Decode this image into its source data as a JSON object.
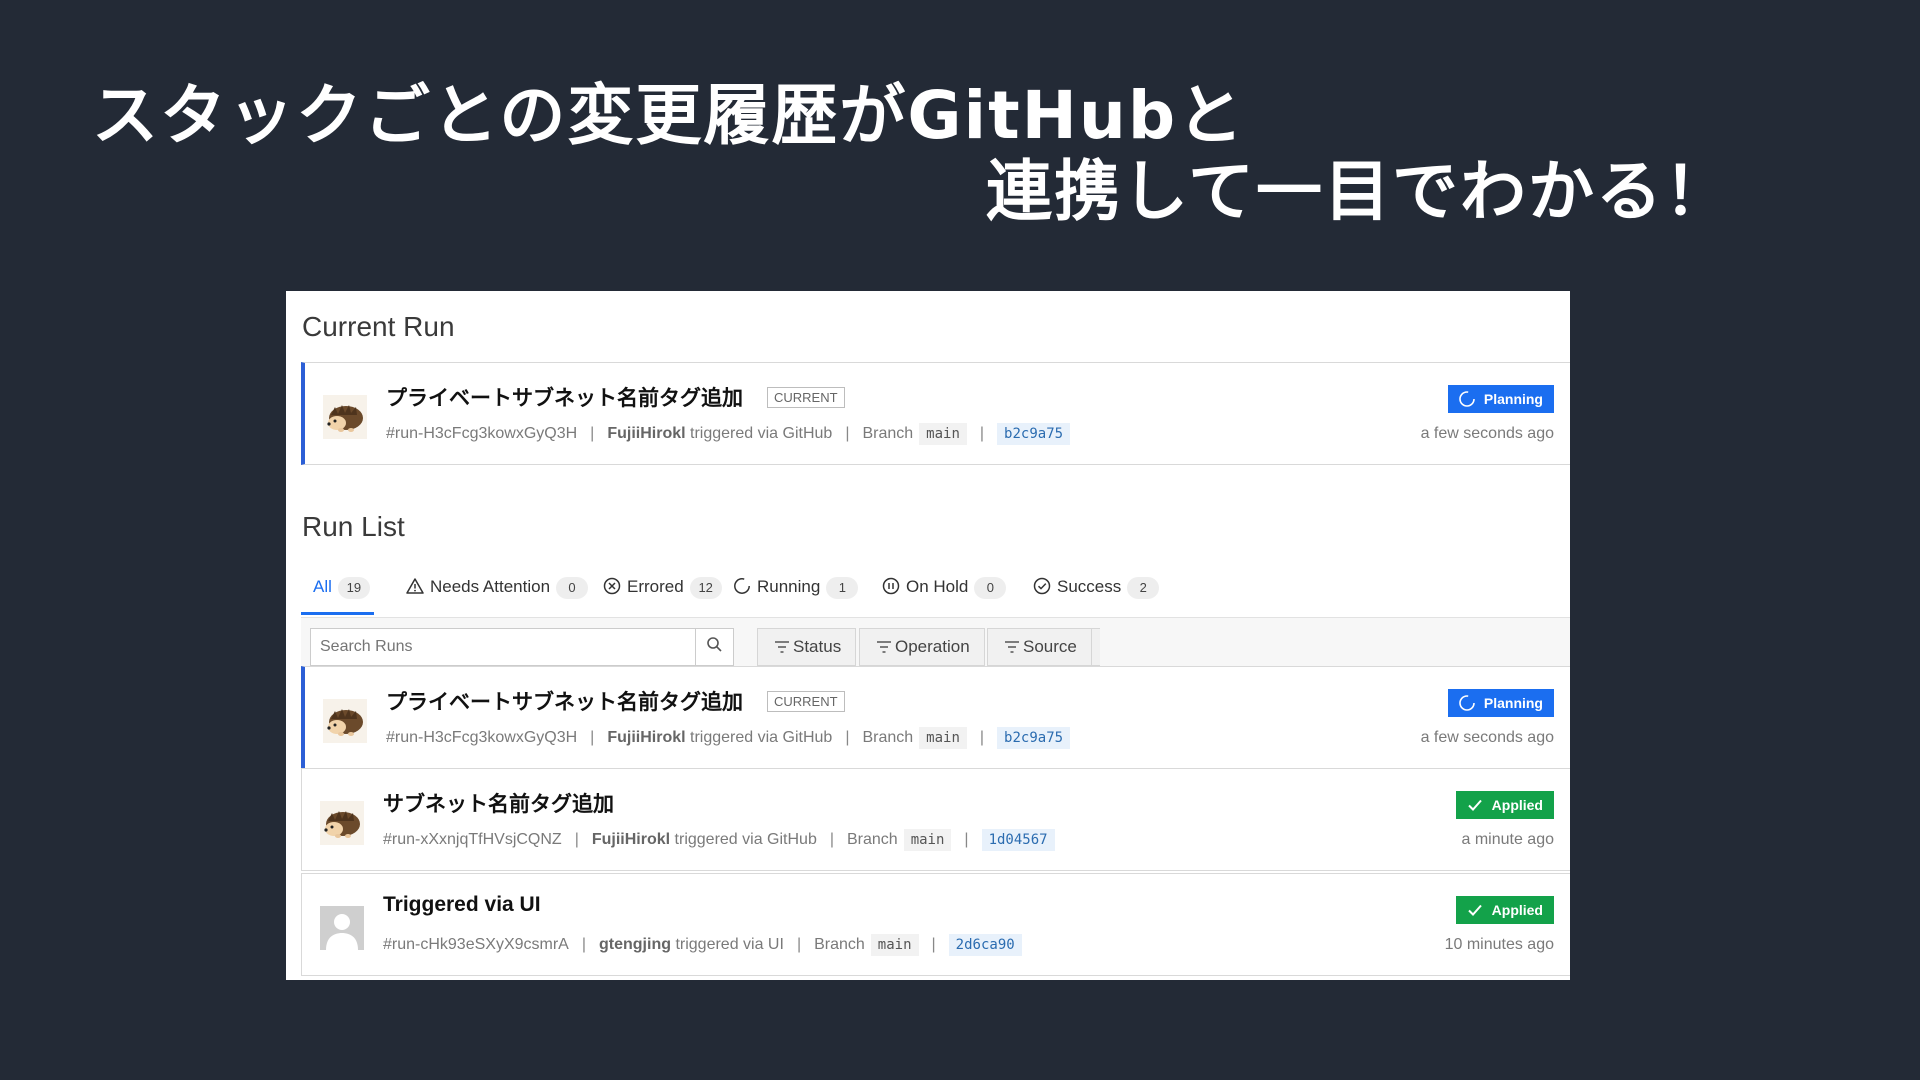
{
  "slide": {
    "title_line1": "スタックごとの変更履歴がGitHubと",
    "title_line2": "連携して一目でわかる！"
  },
  "current_run": {
    "heading": "Current Run",
    "run": {
      "title": "プライベートサブネット名前タグ追加",
      "tag": "CURRENT",
      "id": "#run-H3cFcg3kowxGyQ3H",
      "user": "FujiiHirokl",
      "trigger": "triggered via GitHub",
      "branch_label": "Branch",
      "branch": "main",
      "sha": "b2c9a75",
      "status": "Planning",
      "time": "a few seconds ago"
    }
  },
  "run_list": {
    "heading": "Run List",
    "tabs": [
      {
        "label": "All",
        "count": "19"
      },
      {
        "label": "Needs Attention",
        "count": "0"
      },
      {
        "label": "Errored",
        "count": "12"
      },
      {
        "label": "Running",
        "count": "1"
      },
      {
        "label": "On Hold",
        "count": "0"
      },
      {
        "label": "Success",
        "count": "2"
      }
    ],
    "search_placeholder": "Search Runs",
    "filters": [
      "Status",
      "Operation",
      "Source"
    ],
    "runs": [
      {
        "title": "プライベートサブネット名前タグ追加",
        "tag": "CURRENT",
        "id": "#run-H3cFcg3kowxGyQ3H",
        "user": "FujiiHirokl",
        "trigger": "triggered via GitHub",
        "branch_label": "Branch",
        "branch": "main",
        "sha": "b2c9a75",
        "status": "Planning",
        "time": "a few seconds ago"
      },
      {
        "title": "サブネット名前タグ追加",
        "id": "#run-xXxnjqTfHVsjCQNZ",
        "user": "FujiiHirokl",
        "trigger": "triggered via GitHub",
        "branch_label": "Branch",
        "branch": "main",
        "sha": "1d04567",
        "status": "Applied",
        "time": "a minute ago"
      },
      {
        "title": "Triggered via UI",
        "id": "#run-cHk93eSXyX9csmrA",
        "user": "gtengjing",
        "trigger": "triggered via UI",
        "branch_label": "Branch",
        "branch": "main",
        "sha": "2d6ca90",
        "status": "Applied",
        "time": "10 minutes ago"
      }
    ]
  },
  "colors": {
    "background": "#232a36",
    "planning": "#1b6ef0",
    "applied": "#13a24a",
    "active_border": "#2c5fd6"
  }
}
